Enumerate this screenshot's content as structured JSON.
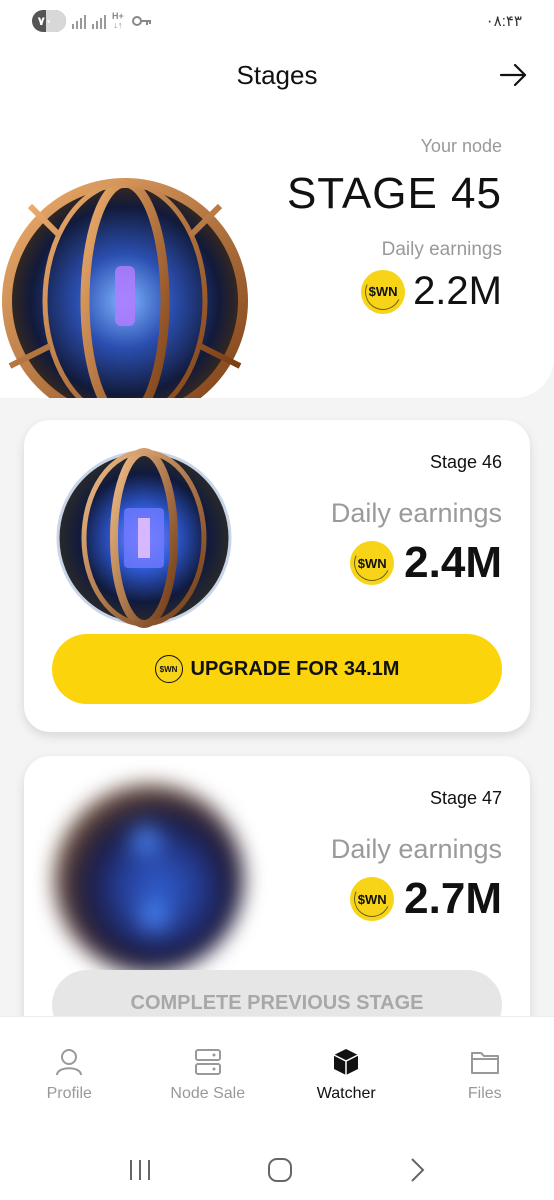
{
  "status_bar": {
    "battery": "۷۰",
    "network": [
      "H+",
      "↓↑"
    ],
    "time": "۰۸:۴۳"
  },
  "header": {
    "title": "Stages",
    "forward_icon": "arrow-right-icon"
  },
  "current_node": {
    "label": "Your node",
    "stage": "STAGE 45",
    "earnings_label": "Daily earnings",
    "coin": "$WN",
    "earnings": "2.2M"
  },
  "stages": [
    {
      "stage": "Stage 46",
      "earnings_label": "Daily earnings",
      "coin": "$WN",
      "earnings": "2.4M",
      "button_coin": "$WN",
      "button_label": "UPGRADE FOR 34.1M"
    },
    {
      "stage": "Stage 47",
      "earnings_label": "Daily earnings",
      "coin": "$WN",
      "earnings": "2.7M",
      "button_label": "COMPLETE PREVIOUS STAGE"
    }
  ],
  "nav": [
    {
      "label": "Profile",
      "icon": "person-icon"
    },
    {
      "label": "Node Sale",
      "icon": "server-icon"
    },
    {
      "label": "Watcher",
      "icon": "cube-icon"
    },
    {
      "label": "Files",
      "icon": "folder-icon"
    }
  ],
  "colors": {
    "accent": "#fbd40b",
    "disabled": "#e6e6e6"
  }
}
